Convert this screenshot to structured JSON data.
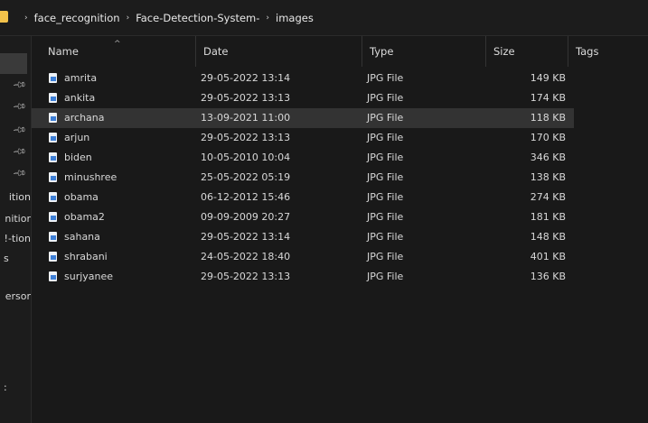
{
  "breadcrumb": {
    "items": [
      "face_recognition",
      "Face-Detection-System-",
      "images"
    ],
    "separator": "›"
  },
  "navpane": {
    "labels": [
      "ition",
      "nitior",
      "tion-!",
      "s",
      "ersor",
      ":"
    ]
  },
  "columns": {
    "name": "Name",
    "date": "Date",
    "type": "Type",
    "size": "Size",
    "tags": "Tags"
  },
  "files": [
    {
      "name": "amrita",
      "date": "29-05-2022 13:14",
      "type": "JPG File",
      "size": "149 KB"
    },
    {
      "name": "ankita",
      "date": "29-05-2022 13:13",
      "type": "JPG File",
      "size": "174 KB"
    },
    {
      "name": "archana",
      "date": "13-09-2021 11:00",
      "type": "JPG File",
      "size": "118 KB",
      "selected": true
    },
    {
      "name": "arjun",
      "date": "29-05-2022 13:13",
      "type": "JPG File",
      "size": "170 KB"
    },
    {
      "name": "biden",
      "date": "10-05-2010 10:04",
      "type": "JPG File",
      "size": "346 KB"
    },
    {
      "name": "minushree",
      "date": "25-05-2022 05:19",
      "type": "JPG File",
      "size": "138 KB"
    },
    {
      "name": "obama",
      "date": "06-12-2012 15:46",
      "type": "JPG File",
      "size": "274 KB"
    },
    {
      "name": "obama2",
      "date": "09-09-2009 20:27",
      "type": "JPG File",
      "size": "181 KB"
    },
    {
      "name": "sahana",
      "date": "29-05-2022 13:14",
      "type": "JPG File",
      "size": "148 KB"
    },
    {
      "name": "shrabani",
      "date": "24-05-2022 18:40",
      "type": "JPG File",
      "size": "401 KB"
    },
    {
      "name": "surjyanee",
      "date": "29-05-2022 13:13",
      "type": "JPG File",
      "size": "136 KB"
    }
  ],
  "colors": {
    "background": "#191919",
    "selected_row": "#333333",
    "folder_icon": "#f2c24a",
    "file_icon_accent": "#3d7fd6"
  }
}
